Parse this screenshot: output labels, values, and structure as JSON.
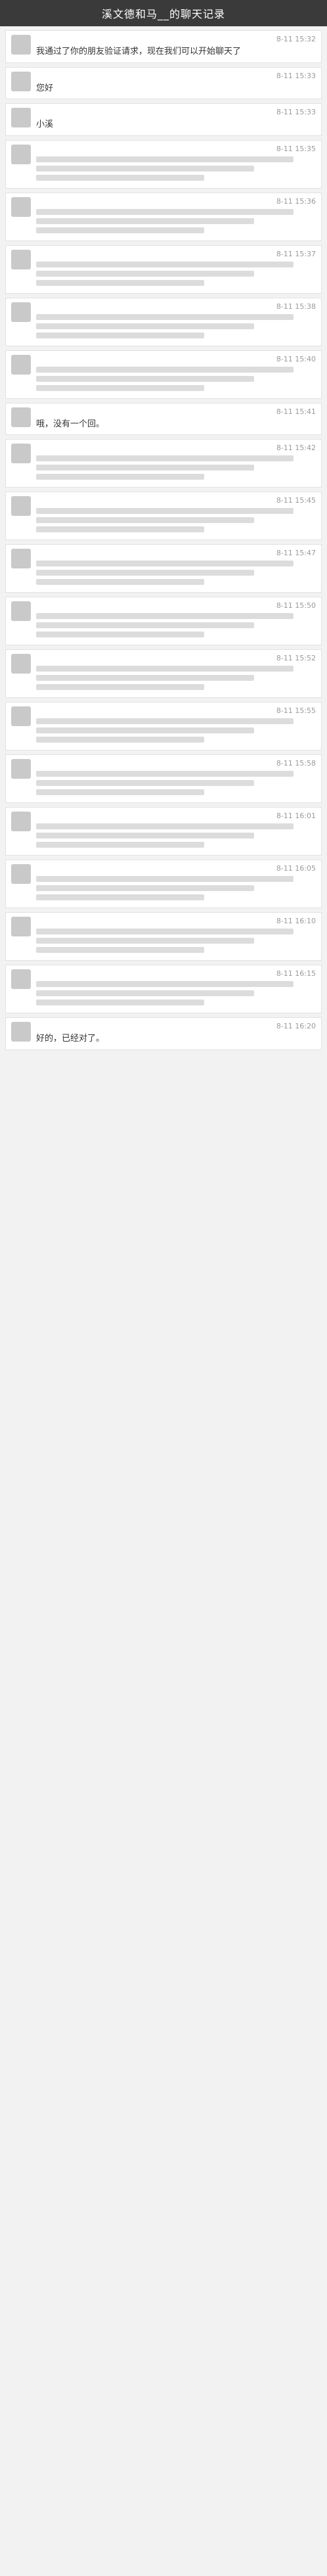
{
  "title": "溪文德和马__的聊天记录",
  "messages": [
    {
      "time": "8-11 15:32",
      "text": "我通过了你的朋友验证请求，现在我们可以开始聊天了"
    },
    {
      "time": "8-11 15:33",
      "text": "您好"
    },
    {
      "time": "8-11 15:33",
      "text": "小溪"
    },
    {
      "time": "8-11 15:35",
      "text": ""
    },
    {
      "time": "8-11 15:36",
      "text": ""
    },
    {
      "time": "8-11 15:37",
      "text": ""
    },
    {
      "time": "8-11 15:38",
      "text": ""
    },
    {
      "time": "8-11 15:40",
      "text": ""
    },
    {
      "time": "8-11 15:41",
      "text": "哦，没有一个回。"
    },
    {
      "time": "8-11 15:42",
      "text": ""
    },
    {
      "time": "8-11 15:45",
      "text": ""
    },
    {
      "time": "8-11 15:47",
      "text": ""
    },
    {
      "time": "8-11 15:50",
      "text": ""
    },
    {
      "time": "8-11 15:52",
      "text": ""
    },
    {
      "time": "8-11 15:55",
      "text": ""
    },
    {
      "time": "8-11 15:58",
      "text": ""
    },
    {
      "time": "8-11 16:01",
      "text": ""
    },
    {
      "time": "8-11 16:05",
      "text": ""
    },
    {
      "time": "8-11 16:10",
      "text": ""
    },
    {
      "time": "8-11 16:15",
      "text": ""
    },
    {
      "time": "8-11 16:20",
      "text": "好的，已经对了。"
    }
  ]
}
